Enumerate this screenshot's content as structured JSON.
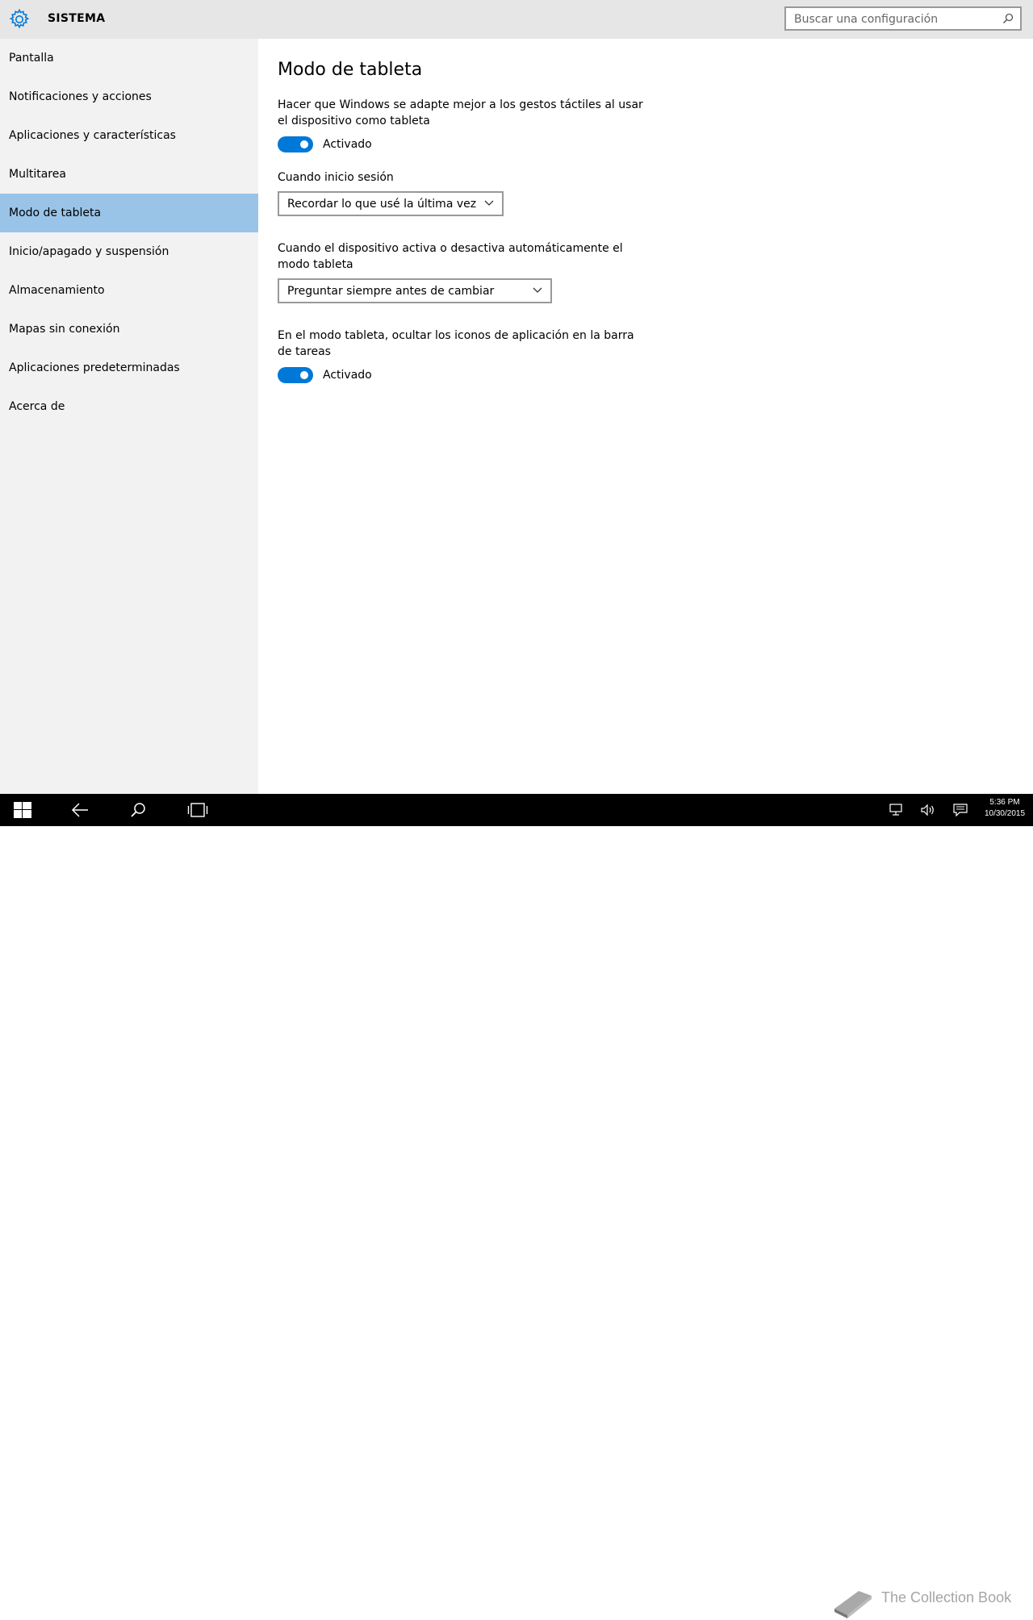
{
  "header": {
    "title": "SISTEMA",
    "search_placeholder": "Buscar una configuración",
    "accent": "#0078d7"
  },
  "sidebar": {
    "items": [
      {
        "label": "Pantalla"
      },
      {
        "label": "Notificaciones y acciones"
      },
      {
        "label": "Aplicaciones y características"
      },
      {
        "label": "Multitarea"
      },
      {
        "label": "Modo de tableta",
        "selected": true
      },
      {
        "label": "Inicio/apagado y suspensión"
      },
      {
        "label": "Almacenamiento"
      },
      {
        "label": "Mapas sin conexión"
      },
      {
        "label": "Aplicaciones predeterminadas"
      },
      {
        "label": "Acerca de"
      }
    ]
  },
  "main": {
    "title": "Modo de tableta",
    "setting1": {
      "description": "Hacer que Windows se adapte mejor a los gestos táctiles al usar el dispositivo como tableta",
      "toggle_state": "Activado",
      "on": true
    },
    "setting2": {
      "label": "Cuando inicio sesión",
      "selected": "Recordar lo que usé la última vez"
    },
    "setting3": {
      "label": "Cuando el dispositivo activa o desactiva automáticamente el modo tableta",
      "selected": "Preguntar siempre antes de cambiar"
    },
    "setting4": {
      "description": "En el modo tableta, ocultar los iconos de aplicación en la barra de tareas",
      "toggle_state": "Activado",
      "on": true
    }
  },
  "taskbar": {
    "buttons": [
      "windows-start-icon",
      "back-arrow-icon",
      "search-icon",
      "task-view-icon"
    ],
    "tray": [
      "network-icon",
      "volume-icon",
      "action-center-icon"
    ],
    "time": "5:36 PM",
    "date": "10/30/2015"
  },
  "watermark": {
    "text": "The Collection Book"
  }
}
